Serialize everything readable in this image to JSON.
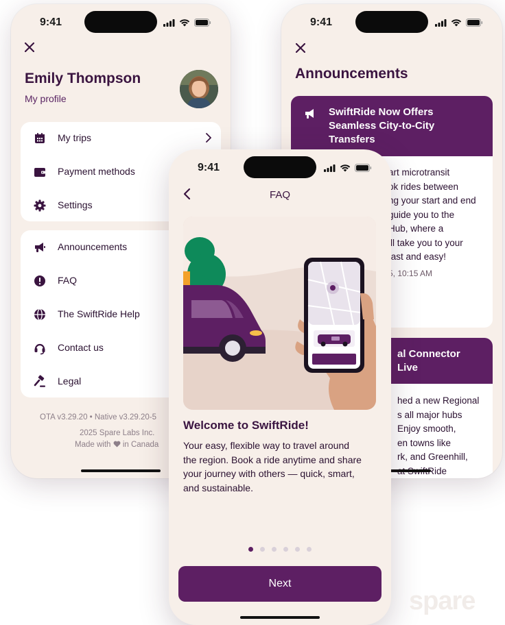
{
  "status_bar": {
    "time": "9:41"
  },
  "profile_screen": {
    "name": "Emily Thompson",
    "subtitle": "My profile",
    "menu_group_1": [
      {
        "label": "My trips",
        "icon": "calendar-icon"
      },
      {
        "label": "Payment methods",
        "icon": "wallet-icon"
      },
      {
        "label": "Settings",
        "icon": "gear-icon"
      }
    ],
    "menu_group_2": [
      {
        "label": "Announcements",
        "icon": "megaphone-icon"
      },
      {
        "label": "FAQ",
        "icon": "alert-circle-icon"
      },
      {
        "label": "The SwiftRide Help",
        "icon": "globe-icon"
      },
      {
        "label": "Contact us",
        "icon": "headset-icon"
      },
      {
        "label": "Legal",
        "icon": "gavel-icon"
      }
    ],
    "footer": {
      "version": "OTA v3.29.20 • Native v3.29.20-5",
      "copyright": "2025 Spare Labs Inc.",
      "made_with_prefix": "Made with",
      "made_with_suffix": "in Canada"
    }
  },
  "announcements_screen": {
    "title": "Announcements",
    "items": [
      {
        "title_lines": [
          "SwiftRide Now Offers",
          "Seamless City-to-City",
          "Transfers"
        ],
        "body_lines": [
          "art microtransit",
          "ok rides between",
          "ng your start and end",
          "guide you to the",
          "Hub, where a",
          "ill take you to your",
          "fast and easy!"
        ],
        "date": "5, 10:15 AM"
      },
      {
        "title_lines": [
          "al Connector",
          "Live"
        ],
        "body_lines": [
          "hed a new Regional",
          "s all major hubs",
          "Enjoy smooth,",
          "en towns like",
          "rk, and Greenhill,",
          "at SwiftRide"
        ]
      }
    ]
  },
  "faq_screen": {
    "title": "FAQ",
    "heading": "Welcome to SwiftRide!",
    "body_lines": [
      "Your easy, flexible way to travel around",
      "the region. Book a ride anytime and share",
      "your journey with others — quick, smart,",
      "and sustainable."
    ],
    "pagination": {
      "total": 6,
      "current": 1
    },
    "next_label": "Next"
  },
  "colors": {
    "brand_purple": "#5d1f63",
    "background": "#f7efe9"
  },
  "watermark": "spare"
}
